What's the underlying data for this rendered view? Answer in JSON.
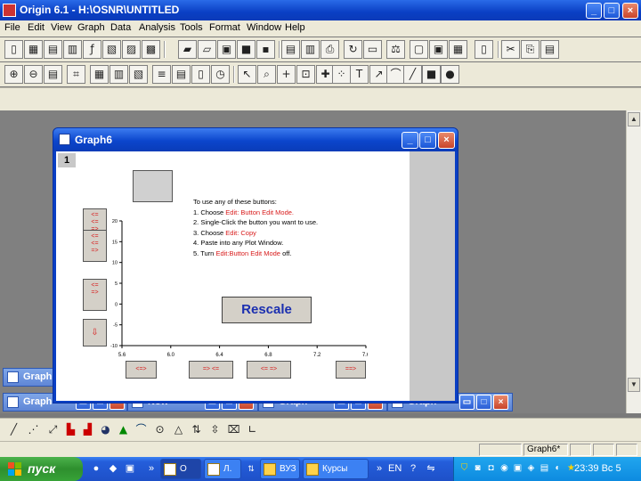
{
  "app": {
    "title": "Origin 6.1 - H:\\OSNR\\UNTITLED",
    "caption_min": "_",
    "caption_max": "□",
    "caption_close": "×"
  },
  "menu": [
    "File",
    "Edit",
    "View",
    "Graph",
    "Data",
    "Analysis",
    "Tools",
    "Format",
    "Window",
    "Help"
  ],
  "minimized": [
    {
      "label": "Graph"
    },
    {
      "label": "Graph"
    },
    {
      "label": "Now"
    },
    {
      "label": "Graph"
    },
    {
      "label": "Graph"
    }
  ],
  "graph_window": {
    "title": "Graph6",
    "layer": "1",
    "side_buttons": [
      "<=\n<=\n=>",
      "<=\n<=\n=>",
      "<=\n=>",
      "⇩"
    ],
    "instructions": [
      {
        "prefix": "To use any of these buttons:",
        "red": "",
        "suffix": ""
      },
      {
        "prefix": "1. Choose ",
        "red": "Edit: Button Edit Mode.",
        "suffix": ""
      },
      {
        "prefix": "2. Single-Click the button you want to use.",
        "red": "",
        "suffix": ""
      },
      {
        "prefix": "3. Choose ",
        "red": "Edit: Copy",
        "suffix": ""
      },
      {
        "prefix": "4. Paste into any Plot Window.",
        "red": "",
        "suffix": ""
      },
      {
        "prefix": "5. Turn ",
        "red": "Edit:Button Edit Mode",
        "suffix": " off."
      }
    ],
    "rescale_label": "Rescale",
    "bottom_buttons": [
      "<=>",
      "=> <=",
      "<= =>",
      "==>"
    ]
  },
  "chart_data": {
    "type": "line",
    "x_ticks": [
      "5.6",
      "6.0",
      "6.4",
      "6.8",
      "7.2",
      "7.6"
    ],
    "y_ticks": [
      "20",
      "15",
      "10",
      "5",
      "0",
      "-5",
      "-10"
    ],
    "xlim": [
      5.6,
      7.6
    ],
    "ylim": [
      -10,
      20
    ],
    "series": [],
    "grid": false
  },
  "toolbar_icons": [
    "new-worksheet-icon",
    "new-graph-icon",
    "open-icon",
    "save-icon",
    "print-icon",
    "refresh-icon",
    "copy-icon",
    "layout-icon",
    "pointer-icon",
    "zoom-icon",
    "crosshair-icon",
    "text-icon",
    "arrow-icon",
    "line-icon",
    "rectangle-icon",
    "ellipse-icon"
  ],
  "statusbar": {
    "window": "Graph6*"
  },
  "taskbar": {
    "start": "пуск",
    "tasks": [
      {
        "label": "O"
      },
      {
        "label": "Л."
      },
      {
        "label": "ВУЗ"
      },
      {
        "label": "Курсы"
      }
    ],
    "lang": "EN",
    "clock": "23:39 Вс 5"
  }
}
